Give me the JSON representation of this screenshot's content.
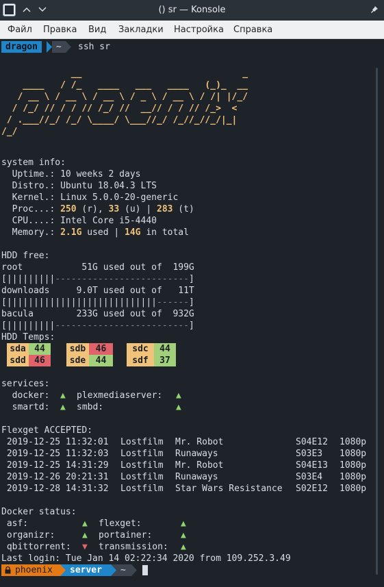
{
  "window": {
    "title": "() sr — Konsole",
    "minimize_icon": "chevron-up-icon",
    "maximize_icon": "chevron-down-icon",
    "pin_icon": "pin-icon"
  },
  "menu": {
    "file": "Файл",
    "edit": "Правка",
    "view": "Вид",
    "bookmarks": "Закладки",
    "settings": "Настройка",
    "help": "Справка"
  },
  "prompt1": {
    "host": "dragon",
    "dir": "~",
    "command": "ssh sr"
  },
  "ascii_art": [
    "             __                              _",
    "    ____   / /_   ____   ___   ____   (_)_  __",
    "   / __ \\ / __ \\ / __ \\ / _ \\ / __ \\ / /| |/_/",
    "  / /_/ // / / // /_/ //  __// / / // /_>  <",
    " / .___//_/ /_/ \\____/ \\___//_/ /_//_//_/|_|",
    "/_/"
  ],
  "system": {
    "header": "system info:",
    "uptime_label": "  Uptime.: ",
    "uptime": "10 weeks 2 days",
    "distro_label": "  Distro.: ",
    "distro": "Ubuntu 18.04.3 LTS",
    "kernel_label": "  Kernel.: ",
    "kernel": "Linux 5.0.0-20-generic",
    "proc_label": "  Proc...: ",
    "proc_running": "250",
    "proc_r": " (r), ",
    "proc_user": "33",
    "proc_u": " (u) | ",
    "proc_total": "283",
    "proc_t": " (t)",
    "cpu_label": "  CPU....: ",
    "cpu": "Intel Core i5-4440",
    "memory_label": "  Memory.: ",
    "memory_used": "2.1G",
    "memory_used_text": " used | ",
    "memory_total": "14G",
    "memory_total_text": " in total"
  },
  "hdd": {
    "header": "HDD free:",
    "disks": [
      {
        "line": "root           51G used out of  199G",
        "bar_fill": "|||||||||",
        "bar_rest": "-------------------------",
        "open": "[",
        "close": "]"
      },
      {
        "line": "downloads     9.0T used out of   11T",
        "bar_fill": "||||||||||||||||||||||||||||",
        "bar_rest": "------",
        "open": "[",
        "close": "]"
      },
      {
        "line": "bacula        233G used out of  932G",
        "bar_fill": "|||||||||",
        "bar_rest": "-------------------------",
        "open": "[",
        "close": "]"
      }
    ],
    "temps_header": "HDD Temps:",
    "temps": [
      {
        "name": "sda",
        "value": "44",
        "status": "ok"
      },
      {
        "name": "sdb",
        "value": "46",
        "status": "hot"
      },
      {
        "name": "sdc",
        "value": "44",
        "status": "ok"
      },
      {
        "name": "sdd",
        "value": "46",
        "status": "hot"
      },
      {
        "name": "sde",
        "value": "44",
        "status": "ok"
      },
      {
        "name": "sdf",
        "value": "37",
        "status": "ok"
      }
    ]
  },
  "services": {
    "header": "services:",
    "items": [
      {
        "name": "  docker:",
        "status": "▲"
      },
      {
        "name": "plexmediaserver:",
        "status": "▲"
      },
      {
        "name": "  smartd:",
        "status": "▲"
      },
      {
        "name": "smbd:",
        "status": "▲"
      }
    ]
  },
  "flexget": {
    "header": "Flexget ACCEPTED:",
    "rows": [
      {
        "date": " 2019-12-25 11:32:01",
        "tracker": "Lostfilm",
        "show": "Mr. Robot",
        "episode": "S04E12",
        "quality": "1080p"
      },
      {
        "date": " 2019-12-25 11:32:03",
        "tracker": "Lostfilm",
        "show": "Runaways",
        "episode": "S03E3",
        "quality": "1080p"
      },
      {
        "date": " 2019-12-25 14:31:29",
        "tracker": "Lostfilm",
        "show": "Mr. Robot",
        "episode": "S04E13",
        "quality": "1080p"
      },
      {
        "date": " 2019-12-26 20:21:31",
        "tracker": "Lostfilm",
        "show": "Runaways",
        "episode": "S03E4",
        "quality": "1080p"
      },
      {
        "date": " 2019-12-28 14:31:32",
        "tracker": "Lostfilm",
        "show": "Star Wars Resistance",
        "episode": "S02E12",
        "quality": "1080p"
      }
    ]
  },
  "docker": {
    "header": "Docker status:",
    "items": [
      {
        "name": " asf:",
        "status": "▲",
        "state": "up"
      },
      {
        "name": "flexget:",
        "status": "▲",
        "state": "up"
      },
      {
        "name": " organizr:",
        "status": "▲",
        "state": "up"
      },
      {
        "name": "portainer:",
        "status": "▲",
        "state": "up"
      },
      {
        "name": " qbittorrent:",
        "status": "▼",
        "state": "down"
      },
      {
        "name": "transmission:",
        "status": "▲",
        "state": "up"
      }
    ]
  },
  "last_login": "Last login: Tue Jan 14 02:22:34 2020 from 109.252.3.49",
  "prompt2": {
    "user": "phoenix",
    "host": "server",
    "dir": "~"
  },
  "colors": {
    "host_bg": "#1f86c9",
    "dir_bg": "#3c4550",
    "user_bg": "#e37a16",
    "temp_ok": "#a2cf7a",
    "temp_hot": "#e0636b",
    "temp_name": "#f1c27a"
  }
}
